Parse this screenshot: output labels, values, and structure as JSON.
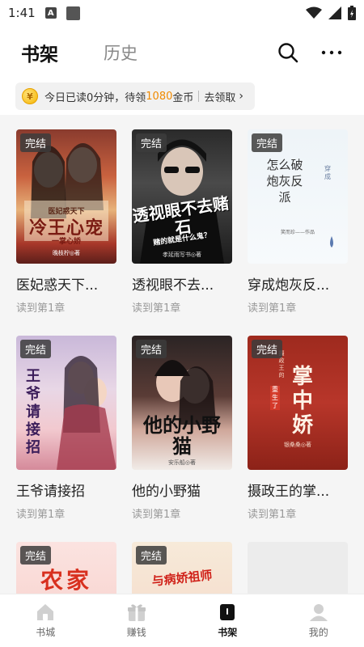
{
  "status_bar": {
    "time": "1:41",
    "badge": "A"
  },
  "header": {
    "tabs": [
      {
        "label": "书架",
        "active": true
      },
      {
        "label": "历史",
        "active": false
      }
    ]
  },
  "banner": {
    "coin_symbol": "¥",
    "prefix": "今日已读0分钟，待领",
    "coins": "1080",
    "suffix": "金币",
    "action": "去领取",
    "arrow": "›"
  },
  "books": [
    {
      "title": "医妃惑天下...",
      "progress": "读到第1章",
      "badge": "完结"
    },
    {
      "title": "透视眼不去...",
      "progress": "读到第1章",
      "badge": "完结"
    },
    {
      "title": "穿成炮灰反...",
      "progress": "读到第1章",
      "badge": "完结"
    },
    {
      "title": "王爷请接招",
      "progress": "读到第1章",
      "badge": "完结"
    },
    {
      "title": "他的小野猫",
      "progress": "读到第1章",
      "badge": "完结"
    },
    {
      "title": "摄政王的掌...",
      "progress": "读到第1章",
      "badge": "完结"
    },
    {
      "title": "",
      "progress": "",
      "badge": "完结"
    },
    {
      "title": "",
      "progress": "",
      "badge": "完结"
    }
  ],
  "covers": {
    "c1_small": "医妃惑天下",
    "c1_main": "冷王心宠",
    "c1_sub": "一掌心娇",
    "c1_author": "晚枝柠◎著",
    "c2_main": "透视眼不去赌石",
    "c2_sub": "赌的就是什么鬼？",
    "c2_author": "孝延雨写书◎著",
    "c3_main": "怎么破炮灰反派",
    "c3_side": "穿成",
    "c3_author": "笑而珍——作品",
    "c4_main": "王爷请接招",
    "c5_main": "他的小野猫",
    "c5_author": "安乐船◎著",
    "c6_main": "掌中娇",
    "c6_side": "摄政王的",
    "c6_sub": "重生了",
    "c6_author": "银桑桑◎著",
    "c7_main": "农家",
    "c8_main": "与病娇祖师"
  },
  "bottom_nav": [
    {
      "label": "书城",
      "icon": "home-icon",
      "active": false
    },
    {
      "label": "赚钱",
      "icon": "gift-icon",
      "active": false
    },
    {
      "label": "书架",
      "icon": "book-icon",
      "active": true
    },
    {
      "label": "我的",
      "icon": "profile-icon",
      "active": false
    }
  ],
  "colors": {
    "accent_orange": "#f08a00",
    "badge_bg": "#3c3c3c",
    "background": "#f5f5f5"
  }
}
